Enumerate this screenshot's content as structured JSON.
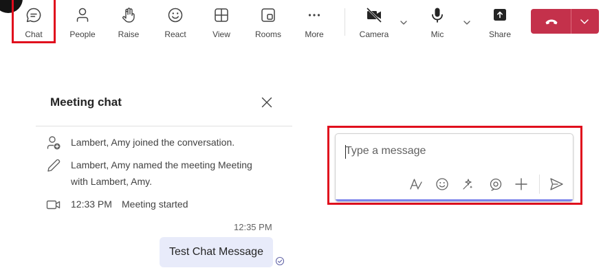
{
  "toolbar": {
    "chat": "Chat",
    "people": "People",
    "raise": "Raise",
    "react": "React",
    "view": "View",
    "rooms": "Rooms",
    "more": "More",
    "camera": "Camera",
    "mic": "Mic",
    "share": "Share"
  },
  "chat_panel": {
    "title": "Meeting chat",
    "events": [
      {
        "icon": "person-joined-icon",
        "text": "Lambert, Amy joined the conversation."
      },
      {
        "icon": "pencil-icon",
        "text_line1": "Lambert, Amy named the meeting Meeting",
        "text_line2": "with Lambert, Amy."
      },
      {
        "icon": "video-camera-icon",
        "time": "12:33 PM",
        "text": "Meeting started"
      }
    ],
    "message": {
      "time": "12:35 PM",
      "text": "Test Chat Message"
    }
  },
  "compose": {
    "placeholder": "Type a message",
    "tools": [
      "format-icon",
      "emoji-icon",
      "copilot-icon",
      "loop-icon",
      "plus-icon",
      "send-icon"
    ]
  },
  "colors": {
    "highlight": "#e00b1c",
    "leave_button": "#c4314b",
    "bubble": "#e8ebfa",
    "accent": "#7b83eb"
  }
}
